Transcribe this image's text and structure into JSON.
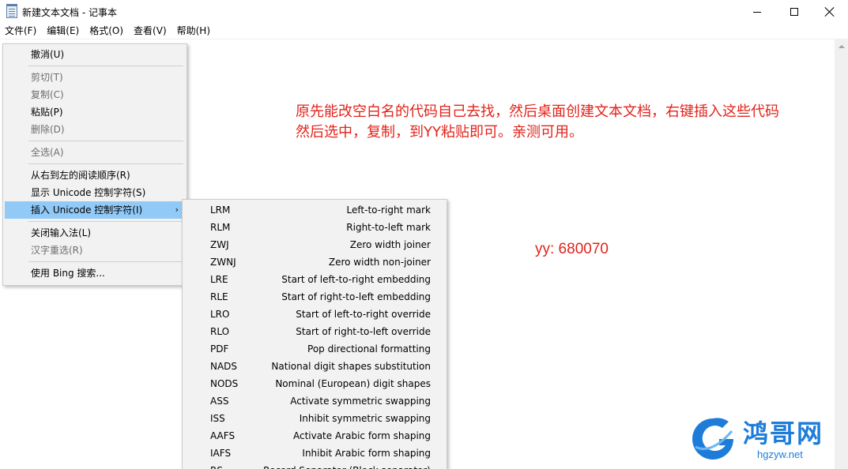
{
  "window": {
    "title": "新建文本文档 - 记事本"
  },
  "menubar": {
    "items": [
      "文件(F)",
      "编辑(E)",
      "格式(O)",
      "查看(V)",
      "帮助(H)"
    ]
  },
  "document": {
    "lines": [
      "原先能改空白名的代码自己去找，然后桌面创建文本文档，右键插入这些代码",
      "然后选中，复制，到YY粘贴即可。亲测可用。"
    ],
    "yy": "yy: 680070",
    "text_color": "#e2231a"
  },
  "context_menu": {
    "items": [
      {
        "label": "撤消(U)",
        "enabled": true
      },
      {
        "label": "剪切(T)",
        "enabled": false
      },
      {
        "label": "复制(C)",
        "enabled": false
      },
      {
        "label": "粘贴(P)",
        "enabled": true
      },
      {
        "label": "删除(D)",
        "enabled": false
      },
      {
        "label": "全选(A)",
        "enabled": false
      },
      {
        "label": "从右到左的阅读顺序(R)",
        "enabled": true
      },
      {
        "label": "显示 Unicode 控制字符(S)",
        "enabled": true
      },
      {
        "label": "插入 Unicode 控制字符(I)",
        "enabled": true,
        "selected": true,
        "has_submenu": true
      },
      {
        "label": "关闭输入法(L)",
        "enabled": true
      },
      {
        "label": "汉字重选(R)",
        "enabled": false
      },
      {
        "label": "使用 Bing 搜索...",
        "enabled": true
      }
    ],
    "submenu_arrow": "›",
    "selected_color": "#91c9f7"
  },
  "submenu": {
    "items": [
      {
        "code": "LRM",
        "desc": "Left-to-right mark"
      },
      {
        "code": "RLM",
        "desc": "Right-to-left mark"
      },
      {
        "code": "ZWJ",
        "desc": "Zero width joiner"
      },
      {
        "code": "ZWNJ",
        "desc": "Zero width non-joiner"
      },
      {
        "code": "LRE",
        "desc": "Start of left-to-right embedding"
      },
      {
        "code": "RLE",
        "desc": "Start of right-to-left embedding"
      },
      {
        "code": "LRO",
        "desc": "Start of left-to-right override"
      },
      {
        "code": "RLO",
        "desc": "Start of right-to-left override"
      },
      {
        "code": "PDF",
        "desc": "Pop directional formatting"
      },
      {
        "code": "NADS",
        "desc": "National digit shapes substitution"
      },
      {
        "code": "NODS",
        "desc": "Nominal (European) digit shapes"
      },
      {
        "code": "ASS",
        "desc": "Activate symmetric swapping"
      },
      {
        "code": "ISS",
        "desc": "Inhibit symmetric swapping"
      },
      {
        "code": "AAFS",
        "desc": "Activate Arabic form shaping"
      },
      {
        "code": "IAFS",
        "desc": "Inhibit Arabic form shaping"
      },
      {
        "code": "RS",
        "desc": "Record Separator (Block separator)"
      }
    ]
  },
  "watermark": {
    "title": "鸿哥网",
    "url": "hgzyw.net",
    "color": "#1e7cd9"
  }
}
